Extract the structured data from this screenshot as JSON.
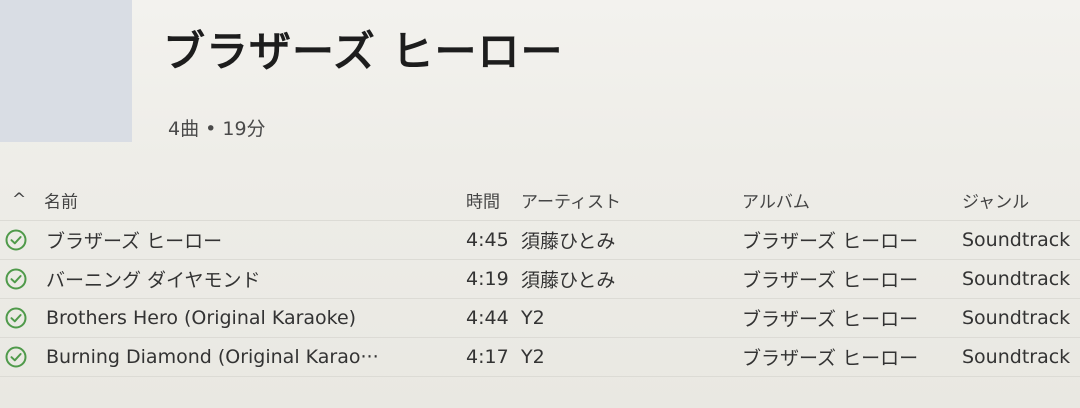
{
  "album": {
    "title": "ブラザーズ ヒーロー",
    "meta": "4曲 • 19分"
  },
  "columns": {
    "name": "名前",
    "time": "時間",
    "artist": "アーティスト",
    "album": "アルバム",
    "genre": "ジャンル"
  },
  "tracks": [
    {
      "name": "ブラザーズ ヒーロー",
      "time": "4:45",
      "artist": "須藤ひとみ",
      "album": "ブラザーズ ヒーロー",
      "genre": "Soundtrack"
    },
    {
      "name": "バーニング ダイヤモンド",
      "time": "4:19",
      "artist": "須藤ひとみ",
      "album": "ブラザーズ ヒーロー",
      "genre": "Soundtrack"
    },
    {
      "name": "Brothers Hero (Original Karaoke)",
      "time": "4:44",
      "artist": "Y2",
      "album": "ブラザーズ ヒーロー",
      "genre": "Soundtrack"
    },
    {
      "name": "Burning Diamond (Original Karao···",
      "time": "4:17",
      "artist": "Y2",
      "album": "ブラザーズ ヒーロー",
      "genre": "Soundtrack"
    }
  ],
  "colors": {
    "check": "#4f9a4a"
  },
  "icons": {
    "sort": "sort-ascending-icon",
    "status": "check-circle-icon"
  }
}
